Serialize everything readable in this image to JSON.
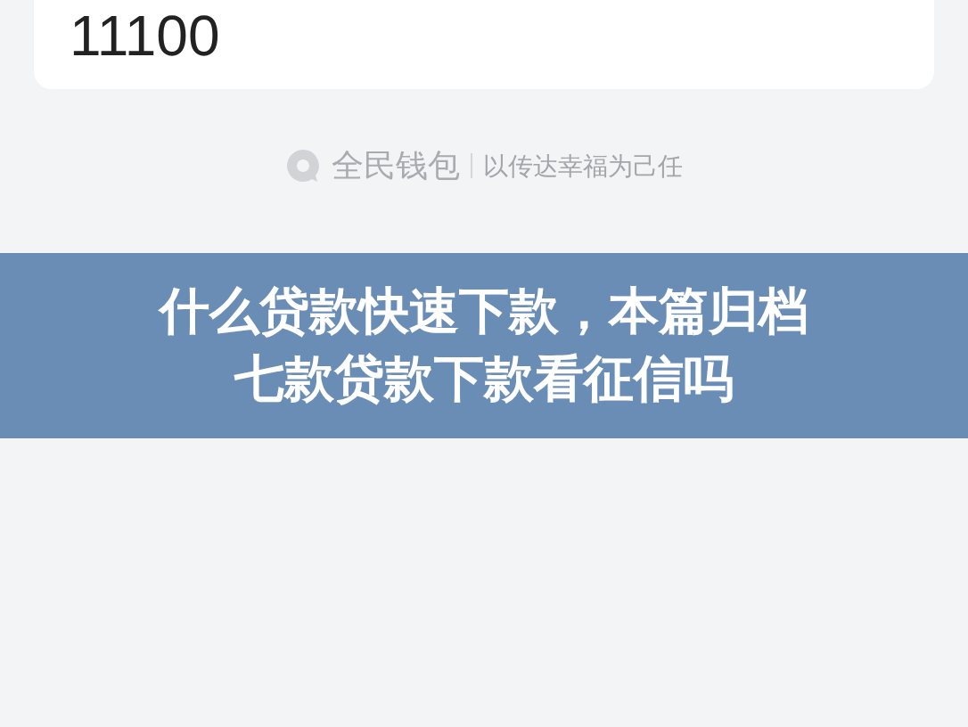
{
  "amount": "11100",
  "brand": {
    "name": "全民钱包",
    "slogan": "以传达幸福为己任"
  },
  "banner": {
    "title_lines": [
      "什么贷款快速下款，本篇归档",
      "七款贷款下款看征信吗"
    ]
  }
}
